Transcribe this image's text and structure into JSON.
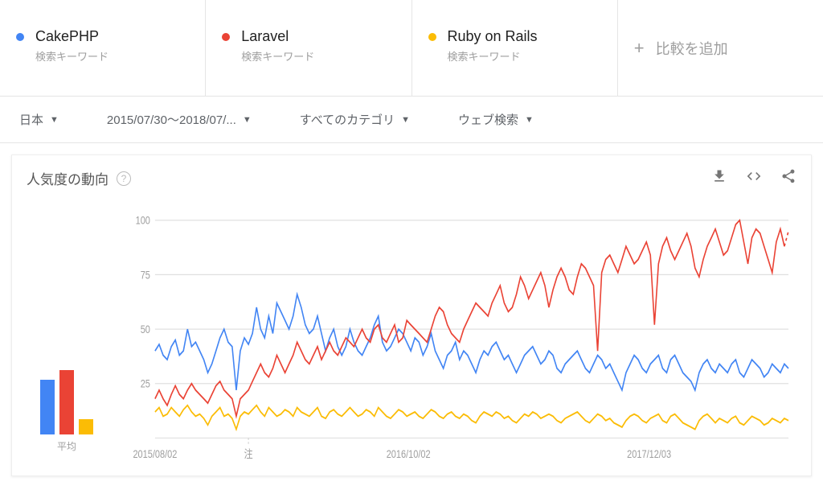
{
  "compare": {
    "sub_label": "検索キーワード",
    "terms": [
      {
        "name": "CakePHP",
        "color": "blue"
      },
      {
        "name": "Laravel",
        "color": "red"
      },
      {
        "name": "Ruby on Rails",
        "color": "yellow"
      }
    ],
    "add_label": "比較を追加"
  },
  "filters": {
    "region": "日本",
    "range": "2015/07/30〜2018/07/...",
    "category": "すべてのカテゴリ",
    "search_type": "ウェブ検索"
  },
  "chart": {
    "title": "人気度の動向",
    "avg_label": "平均",
    "note_label": "注",
    "yticks": [
      "100",
      "75",
      "50",
      "25"
    ],
    "xticks": [
      "2015/08/02",
      "2016/10/02",
      "2017/12/03"
    ]
  },
  "chart_data": {
    "type": "line",
    "title": "人気度の動向",
    "ylabel": "",
    "xlabel": "",
    "ylim": [
      0,
      100
    ],
    "xticks": [
      "2015/08/02",
      "2016/10/02",
      "2017/12/03"
    ],
    "averages": {
      "CakePHP": 40,
      "Laravel": 47,
      "Ruby on Rails": 11
    },
    "annotations": [
      {
        "x_index": 23,
        "label": "注"
      }
    ],
    "series": [
      {
        "name": "CakePHP",
        "color": "#4285f4",
        "values": [
          40,
          43,
          38,
          36,
          42,
          45,
          38,
          40,
          50,
          42,
          44,
          40,
          36,
          30,
          34,
          40,
          46,
          50,
          44,
          42,
          22,
          40,
          46,
          43,
          48,
          60,
          50,
          46,
          56,
          48,
          62,
          58,
          54,
          50,
          56,
          66,
          60,
          52,
          48,
          50,
          56,
          48,
          40,
          46,
          50,
          42,
          38,
          42,
          50,
          44,
          40,
          38,
          42,
          46,
          52,
          56,
          44,
          40,
          42,
          46,
          50,
          48,
          44,
          40,
          46,
          44,
          38,
          42,
          48,
          40,
          36,
          32,
          38,
          40,
          44,
          36,
          40,
          38,
          34,
          30,
          36,
          40,
          38,
          42,
          44,
          40,
          36,
          38,
          34,
          30,
          34,
          38,
          40,
          42,
          38,
          34,
          36,
          40,
          38,
          32,
          30,
          34,
          36,
          38,
          40,
          36,
          32,
          30,
          34,
          38,
          36,
          32,
          34,
          30,
          26,
          22,
          30,
          34,
          38,
          36,
          32,
          30,
          34,
          36,
          38,
          32,
          30,
          36,
          38,
          34,
          30,
          28,
          26,
          22,
          30,
          34,
          36,
          32,
          30,
          34,
          32,
          30,
          34,
          36,
          30,
          28,
          32,
          36,
          34,
          32,
          28,
          30,
          34,
          32,
          30,
          34,
          32
        ]
      },
      {
        "name": "Laravel",
        "color": "#ea4335",
        "values": [
          18,
          22,
          18,
          15,
          20,
          24,
          20,
          18,
          22,
          25,
          22,
          20,
          18,
          16,
          20,
          24,
          26,
          22,
          20,
          18,
          10,
          18,
          20,
          22,
          26,
          30,
          34,
          30,
          28,
          32,
          38,
          34,
          30,
          34,
          38,
          44,
          40,
          36,
          34,
          38,
          42,
          36,
          40,
          44,
          40,
          38,
          42,
          46,
          44,
          42,
          46,
          50,
          46,
          44,
          50,
          52,
          46,
          44,
          48,
          52,
          44,
          46,
          54,
          52,
          50,
          48,
          46,
          44,
          50,
          56,
          60,
          58,
          52,
          48,
          46,
          44,
          50,
          54,
          58,
          62,
          60,
          58,
          56,
          62,
          66,
          70,
          62,
          58,
          60,
          66,
          74,
          70,
          64,
          68,
          72,
          76,
          70,
          60,
          68,
          74,
          78,
          74,
          68,
          66,
          74,
          80,
          78,
          74,
          70,
          40,
          76,
          82,
          84,
          80,
          76,
          82,
          88,
          84,
          80,
          82,
          86,
          90,
          84,
          52,
          80,
          88,
          92,
          86,
          82,
          86,
          90,
          94,
          88,
          78,
          74,
          82,
          88,
          92,
          96,
          90,
          84,
          86,
          92,
          98,
          100,
          90,
          80,
          92,
          96,
          94,
          88,
          82,
          76,
          90,
          96,
          88,
          95
        ]
      },
      {
        "name": "Ruby on Rails",
        "color": "#fbbc05",
        "values": [
          12,
          14,
          10,
          11,
          14,
          12,
          10,
          13,
          15,
          12,
          10,
          11,
          9,
          6,
          10,
          12,
          14,
          10,
          11,
          9,
          4,
          10,
          12,
          11,
          13,
          15,
          12,
          10,
          14,
          12,
          10,
          11,
          13,
          12,
          10,
          14,
          12,
          11,
          10,
          12,
          14,
          10,
          9,
          12,
          13,
          11,
          10,
          12,
          14,
          12,
          10,
          11,
          13,
          12,
          10,
          14,
          12,
          10,
          9,
          11,
          13,
          12,
          10,
          11,
          12,
          10,
          9,
          11,
          13,
          12,
          10,
          9,
          11,
          12,
          10,
          9,
          11,
          10,
          8,
          7,
          10,
          12,
          11,
          10,
          12,
          11,
          9,
          10,
          8,
          7,
          9,
          11,
          10,
          12,
          11,
          9,
          10,
          11,
          10,
          8,
          7,
          9,
          10,
          11,
          12,
          10,
          8,
          7,
          9,
          11,
          10,
          8,
          9,
          7,
          6,
          5,
          8,
          10,
          11,
          10,
          8,
          7,
          9,
          10,
          11,
          8,
          7,
          10,
          11,
          9,
          7,
          6,
          5,
          4,
          8,
          10,
          11,
          9,
          7,
          9,
          8,
          7,
          9,
          10,
          7,
          6,
          8,
          10,
          9,
          8,
          6,
          7,
          9,
          8,
          7,
          9,
          8
        ]
      }
    ]
  }
}
